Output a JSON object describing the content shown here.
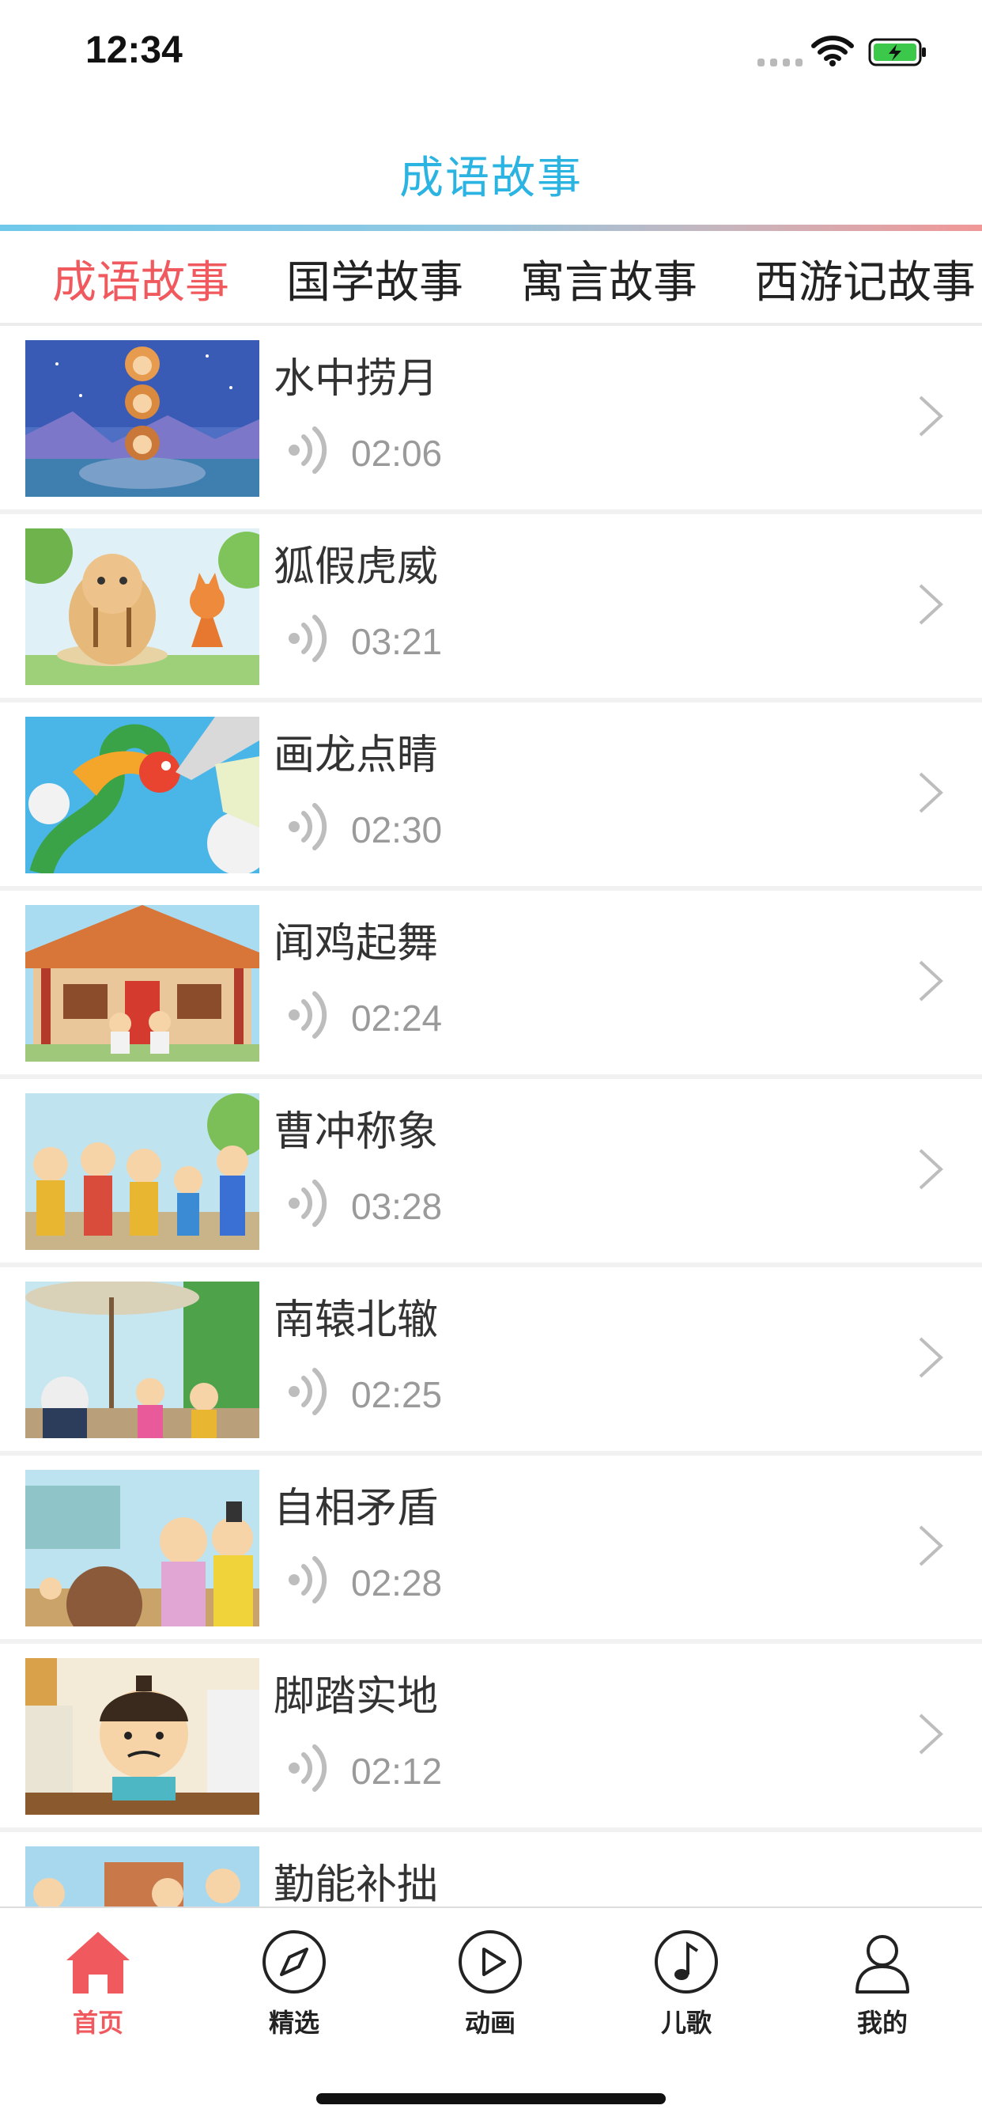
{
  "status_bar": {
    "time": "12:34"
  },
  "nav": {
    "title": "成语故事"
  },
  "tabs": [
    {
      "label": "成语故事",
      "active": true
    },
    {
      "label": "国学故事",
      "active": false
    },
    {
      "label": "寓言故事",
      "active": false
    },
    {
      "label": "西游记故事",
      "active": false
    }
  ],
  "stories": [
    {
      "title": "水中捞月",
      "duration": "02:06",
      "thumb": "monkeys-moon"
    },
    {
      "title": "狐假虎威",
      "duration": "03:21",
      "thumb": "tiger-fox"
    },
    {
      "title": "画龙点睛",
      "duration": "02:30",
      "thumb": "dragon-brush"
    },
    {
      "title": "闻鸡起舞",
      "duration": "02:24",
      "thumb": "temple-boys"
    },
    {
      "title": "曹冲称象",
      "duration": "03:28",
      "thumb": "court-officials"
    },
    {
      "title": "南辕北辙",
      "duration": "02:25",
      "thumb": "carriage-umbrella"
    },
    {
      "title": "自相矛盾",
      "duration": "02:28",
      "thumb": "market-crowd"
    },
    {
      "title": "脚踏实地",
      "duration": "02:12",
      "thumb": "scholar-books"
    },
    {
      "title": "勤能补拙",
      "duration": "",
      "thumb": "soldiers-town"
    }
  ],
  "tabbar": [
    {
      "label": "首页",
      "icon": "home-icon",
      "active": true
    },
    {
      "label": "精选",
      "icon": "compass-icon",
      "active": false
    },
    {
      "label": "动画",
      "icon": "play-icon",
      "active": false
    },
    {
      "label": "儿歌",
      "icon": "music-note-icon",
      "active": false
    },
    {
      "label": "我的",
      "icon": "user-icon",
      "active": false
    }
  ],
  "colors": {
    "accent": "#f05a5e",
    "nav_title": "#2bb3e2",
    "secondary_text": "#9a9a9a"
  }
}
